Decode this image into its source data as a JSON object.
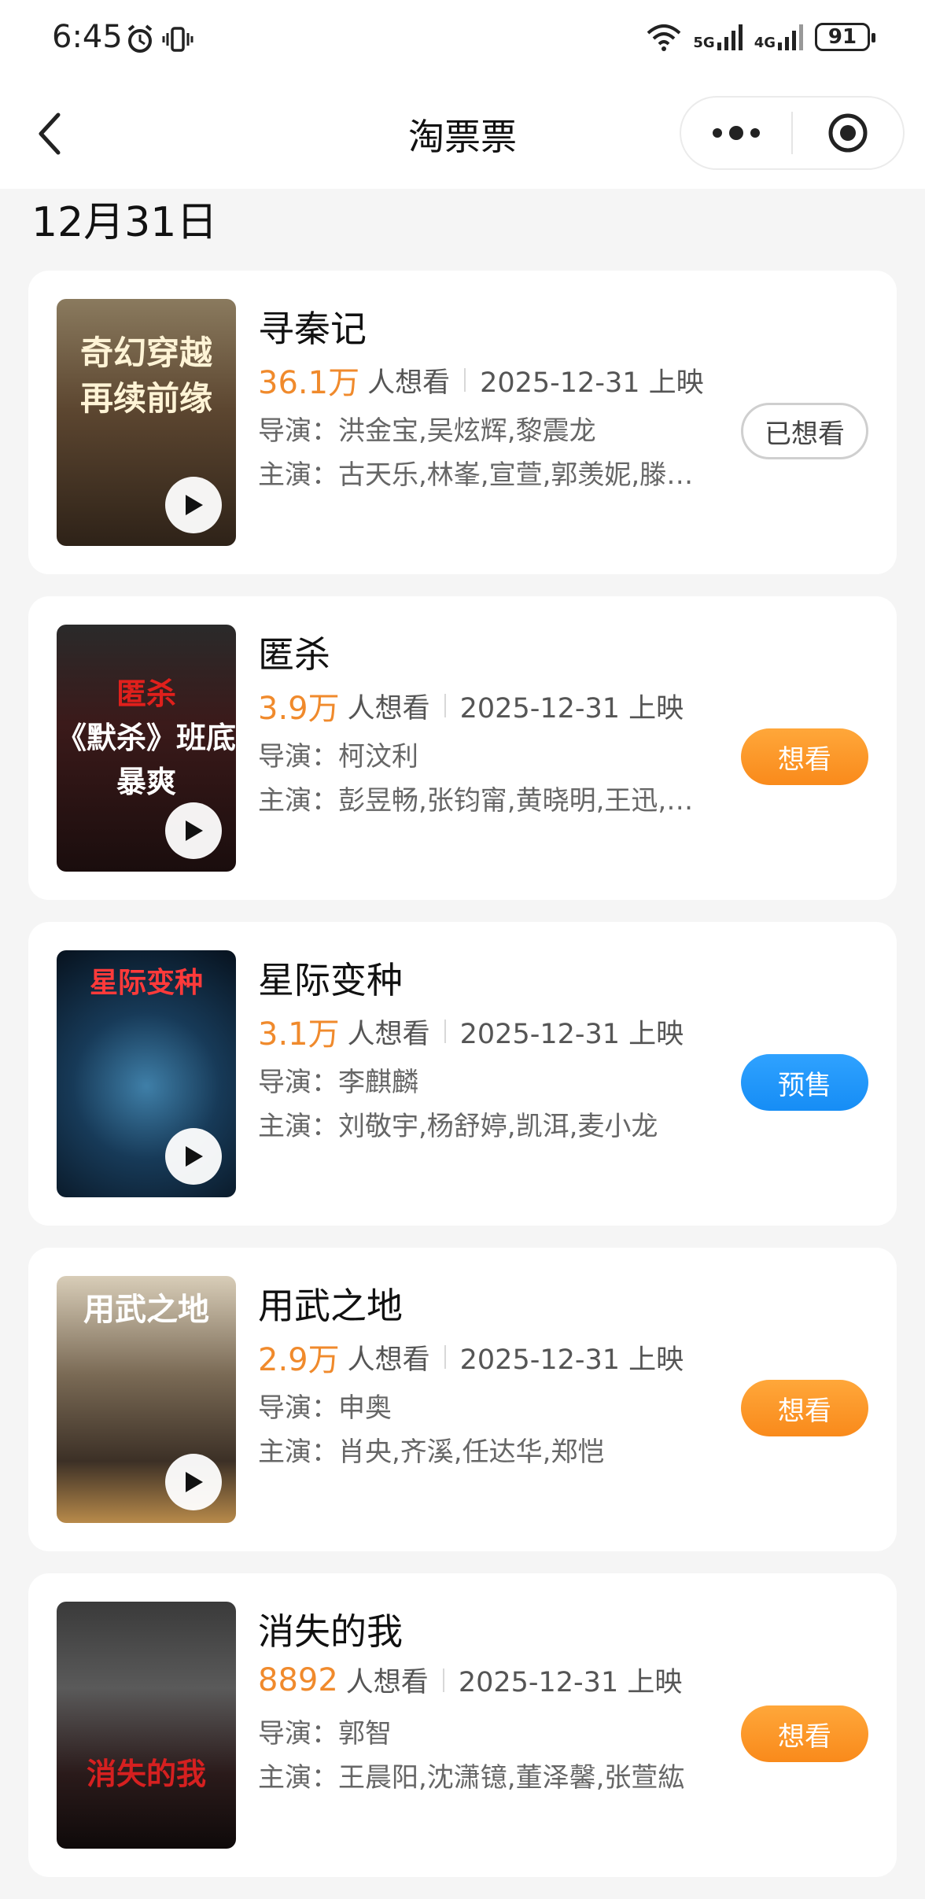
{
  "status_bar": {
    "time": "6:45",
    "network_1": "5G",
    "network_2": "4G",
    "battery": "91"
  },
  "nav": {
    "title": "淘票票"
  },
  "date_heading": "12月31日",
  "movies": [
    {
      "title": "寻秦记",
      "want_count": "36.1万",
      "want_label": "人想看",
      "release": "2025-12-31 上映",
      "director": "导演：洪金宝,吴炫辉,黎震龙",
      "cast": "主演：古天乐,林峯,宣萱,郭羡妮,滕…",
      "action": "已想看",
      "poster_text": "奇幻穿越\n再续前缘"
    },
    {
      "title": "匿杀",
      "want_count": "3.9万",
      "want_label": "人想看",
      "release": "2025-12-31 上映",
      "director": "导演：柯汶利",
      "cast": "主演：彭昱畅,张钧甯,黄晓明,王迅,…",
      "action": "想看",
      "poster_text": "匿杀\n《默杀》班底\n暴爽"
    },
    {
      "title": "星际变种",
      "want_count": "3.1万",
      "want_label": "人想看",
      "release": "2025-12-31 上映",
      "director": "导演：李麒麟",
      "cast": "主演：刘敬宇,杨舒婷,凯洱,麦小龙",
      "action": "预售",
      "poster_text": "星际变种"
    },
    {
      "title": "用武之地",
      "want_count": "2.9万",
      "want_label": "人想看",
      "release": "2025-12-31 上映",
      "director": "导演：申奥",
      "cast": "主演：肖央,齐溪,任达华,郑恺",
      "action": "想看",
      "poster_text": "用武之地"
    },
    {
      "title": "消失的我",
      "want_count": "8892",
      "want_label": "人想看",
      "release": "2025-12-31 上映",
      "director": "导演：郭智",
      "cast": "主演：王晨阳,沈潇镱,董泽馨,张萱紘",
      "action": "想看",
      "poster_text": "消失的我"
    }
  ],
  "colors": {
    "accent_orange": "#f98a1b",
    "presale_blue": "#168df5",
    "want_count": "#f08a2c"
  }
}
